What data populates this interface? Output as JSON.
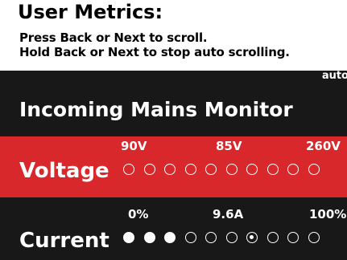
{
  "header": {
    "title": "User Metrics:",
    "instruction_1": "Press Back or Next to scroll.",
    "instruction_2": "Hold Back or Next to stop auto scrolling."
  },
  "panel": {
    "auto_label": "auto",
    "title": "Incoming Mains Monitor"
  },
  "voltage": {
    "label": "Voltage",
    "scale_min": "90V",
    "scale_current": "85V",
    "scale_max": "260V",
    "dots": [
      "empty",
      "empty",
      "empty",
      "empty",
      "empty",
      "empty",
      "empty",
      "empty",
      "empty",
      "empty"
    ]
  },
  "current": {
    "label": "Current",
    "scale_min": "0%",
    "scale_current": "9.6A",
    "scale_max": "100%",
    "dots": [
      "filled",
      "filled",
      "filled",
      "empty",
      "empty",
      "empty",
      "marker",
      "empty",
      "empty",
      "empty"
    ]
  },
  "colors": {
    "voltage_row_bg": "#d8282c",
    "panel_bg": "#181818"
  }
}
